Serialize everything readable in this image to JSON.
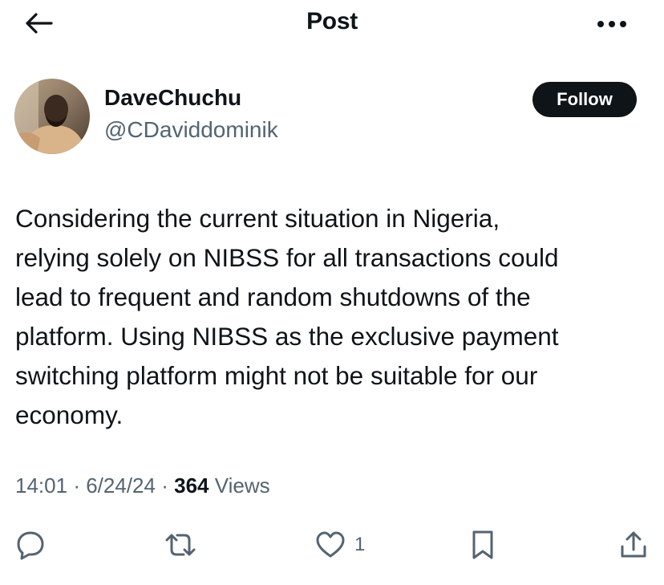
{
  "header": {
    "title": "Post",
    "back_icon": "arrow-left-icon",
    "more_icon": "more-horizontal-icon"
  },
  "author": {
    "display_name": "DaveChuchu",
    "handle": "@CDaviddominik",
    "follow_label": "Follow"
  },
  "post": {
    "text": "Considering the current situation in Nigeria,\nrelying solely on NIBSS for all transactions could\nlead to frequent and random shutdowns of the\nplatform. Using NIBSS as the exclusive payment\nswitching platform might not be suitable for our\neconomy."
  },
  "meta": {
    "time": "14:01",
    "separator": "·",
    "date": "6/24/24",
    "views_count": "364",
    "views_label": "Views"
  },
  "actions": {
    "reply_icon": "reply-icon",
    "repost_icon": "repost-icon",
    "like_icon": "heart-icon",
    "like_count": "1",
    "bookmark_icon": "bookmark-icon",
    "share_icon": "share-icon"
  },
  "colors": {
    "text": "#0f1419",
    "secondary_text": "#536471",
    "follow_button_bg": "#0f1419",
    "follow_button_text": "#ffffff"
  }
}
